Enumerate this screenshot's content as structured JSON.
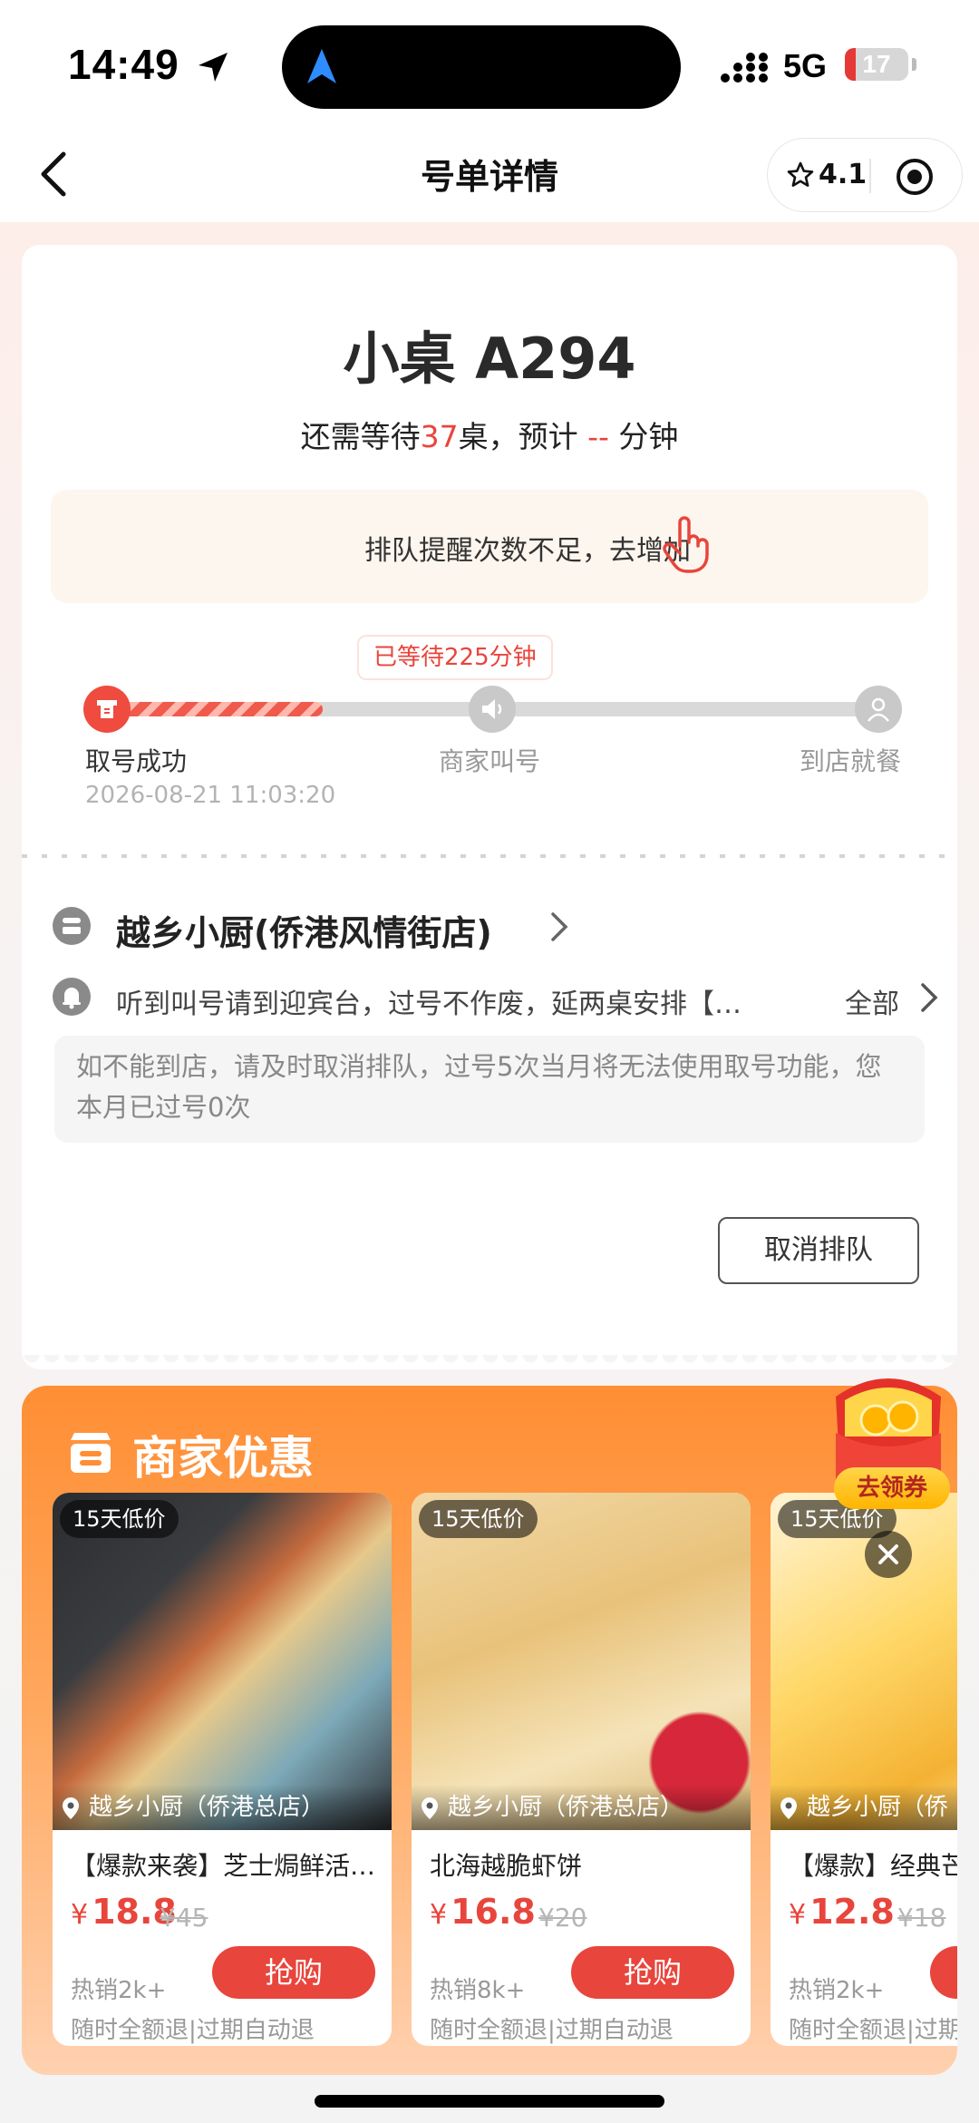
{
  "status_bar": {
    "time": "14:49",
    "network": "5G",
    "battery": "17",
    "battery_level": 0.17
  },
  "nav": {
    "title": "号单详情",
    "rating": "4.1"
  },
  "ticket": {
    "title": "小桌 A294",
    "wait_prefix": "还需等待",
    "wait_tables": "37",
    "wait_mid": "桌，预计",
    "wait_minutes": "--",
    "wait_suffix": "分钟"
  },
  "reminder": {
    "text": "排队提醒次数不足，去增加"
  },
  "progress": {
    "waited_tag": "已等待225分钟",
    "fraction": 0.29,
    "steps": [
      {
        "label": "取号成功",
        "time": "2026-08-21 11:03:20"
      },
      {
        "label": "商家叫号"
      },
      {
        "label": "到店就餐"
      }
    ]
  },
  "shop": {
    "name": "越乡小厨(侨港风情街店)"
  },
  "notice": {
    "text": "听到叫号请到迎宾台，过号不作废，延两桌安排【…",
    "all_label": "全部"
  },
  "hint": {
    "text": "如不能到店，请及时取消排队，过号5次当月将无法使用取号功能，您本月已过号0次"
  },
  "cancel_label": "取消排队",
  "offers": {
    "title": "商家优惠",
    "coupon_label": "去领券",
    "items": [
      {
        "badge": "15天低价",
        "shop": "越乡小厨（侨港总店）",
        "name": "【爆款来袭】芝士焗鲜活…",
        "price": "18.8",
        "yen": "¥",
        "old_price": "¥45",
        "sold": "热销2k+",
        "buy": "抢购",
        "refund": "随时全额退|过期自动退"
      },
      {
        "badge": "15天低价",
        "shop": "越乡小厨（侨港总店）",
        "name": "北海越脆虾饼",
        "price": "16.8",
        "yen": "¥",
        "old_price": "¥20",
        "sold": "热销8k+",
        "buy": "抢购",
        "refund": "随时全额退|过期自动退"
      },
      {
        "badge": "15天低价",
        "shop": "越乡小厨（侨",
        "name": "【爆款】经典芒",
        "price": "12.8",
        "yen": "¥",
        "old_price": "¥18",
        "sold": "热销2k+",
        "buy": "",
        "refund": "随时全额退|过期"
      }
    ]
  },
  "colors": {
    "accent": "#e8453c",
    "offers_bg": "#ff8e34"
  }
}
